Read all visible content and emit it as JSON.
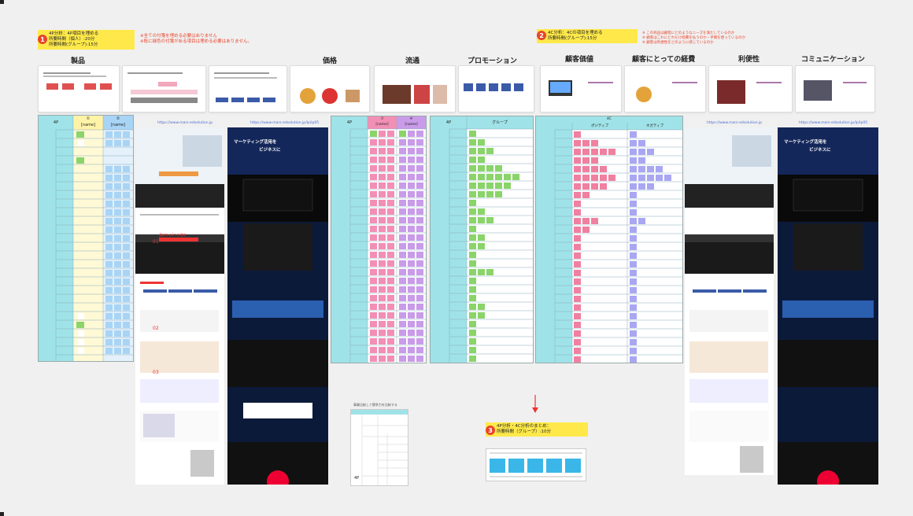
{
  "step1": {
    "num": "1",
    "lines": [
      "4P分析：4P項目を埋める",
      "所要時間（個人）:20分",
      "所要時間(グループ):15分"
    ],
    "notes": [
      "※全ての付箋を埋める必要はありません",
      "※既に緑色の付箋がある項目は埋める必要はありません。"
    ]
  },
  "step2": {
    "num": "2",
    "lines": [
      "4C分析：4Cの項目を埋める",
      "所要時間(グループ):15分"
    ],
    "notes": [
      "※ この商品は顧客にどのようなニーズを満たしているのか",
      "※ 顧客はこれにどれだけ経費を払うのか・手間を使っているのか",
      "※ 顧客は利便性をどのように感じているのか"
    ]
  },
  "step3": {
    "num": "3",
    "lines": [
      "4P分析・4C分析のまとめ：",
      "所要時間（グループ）:10分"
    ]
  },
  "headers": {
    "product": "製品",
    "price": "価格",
    "place": "流通",
    "promotion": "プロモーション",
    "value": "顧客価値",
    "cost": "顧客にとっての経費",
    "convenience": "利便性",
    "communication": "コミュニケーション"
  },
  "urls": {
    "u1": "https://www.mars-edsolution.jp",
    "u2": "https://www.mars-edsolution.jp/lp/lp05",
    "u3": "https://www.mars-edsolution.jp",
    "u4": "https://www.mars-edsolution.jp/lp/lp05"
  },
  "table1": {
    "h0": "4P",
    "h1": "①",
    "h1b": "[name]",
    "h2": "②",
    "h2b": "[name]"
  },
  "table2": {
    "h0": "4P",
    "h1": "⑦",
    "h1b": "[name]",
    "h2": "④",
    "h2b": "[name]"
  },
  "table3": {
    "h0": "4P",
    "h1": "グループ"
  },
  "table4": {
    "h0": "4C",
    "h1": "ポジティブ",
    "h2": "ネガティブ"
  },
  "small_sheet_title": "事業比較して競争力を比較する",
  "small_sheet_label": "4P",
  "lp": {
    "hero_title": "マーケティング活用を",
    "hero_title2": "ビジネスに",
    "section_head": "選ばれる3つの理由",
    "n1": "01",
    "n2": "02",
    "n3": "03"
  },
  "colors": {
    "yellow": "#fff3a8",
    "blue": "#a8d4f5",
    "teal": "#9fe3e8",
    "pink": "#f28fb5",
    "purple": "#c99be8",
    "green": "#8ad46a",
    "indigo": "#a9a7f2",
    "salmon": "#f080a0",
    "navy": "#0c1a3a"
  }
}
